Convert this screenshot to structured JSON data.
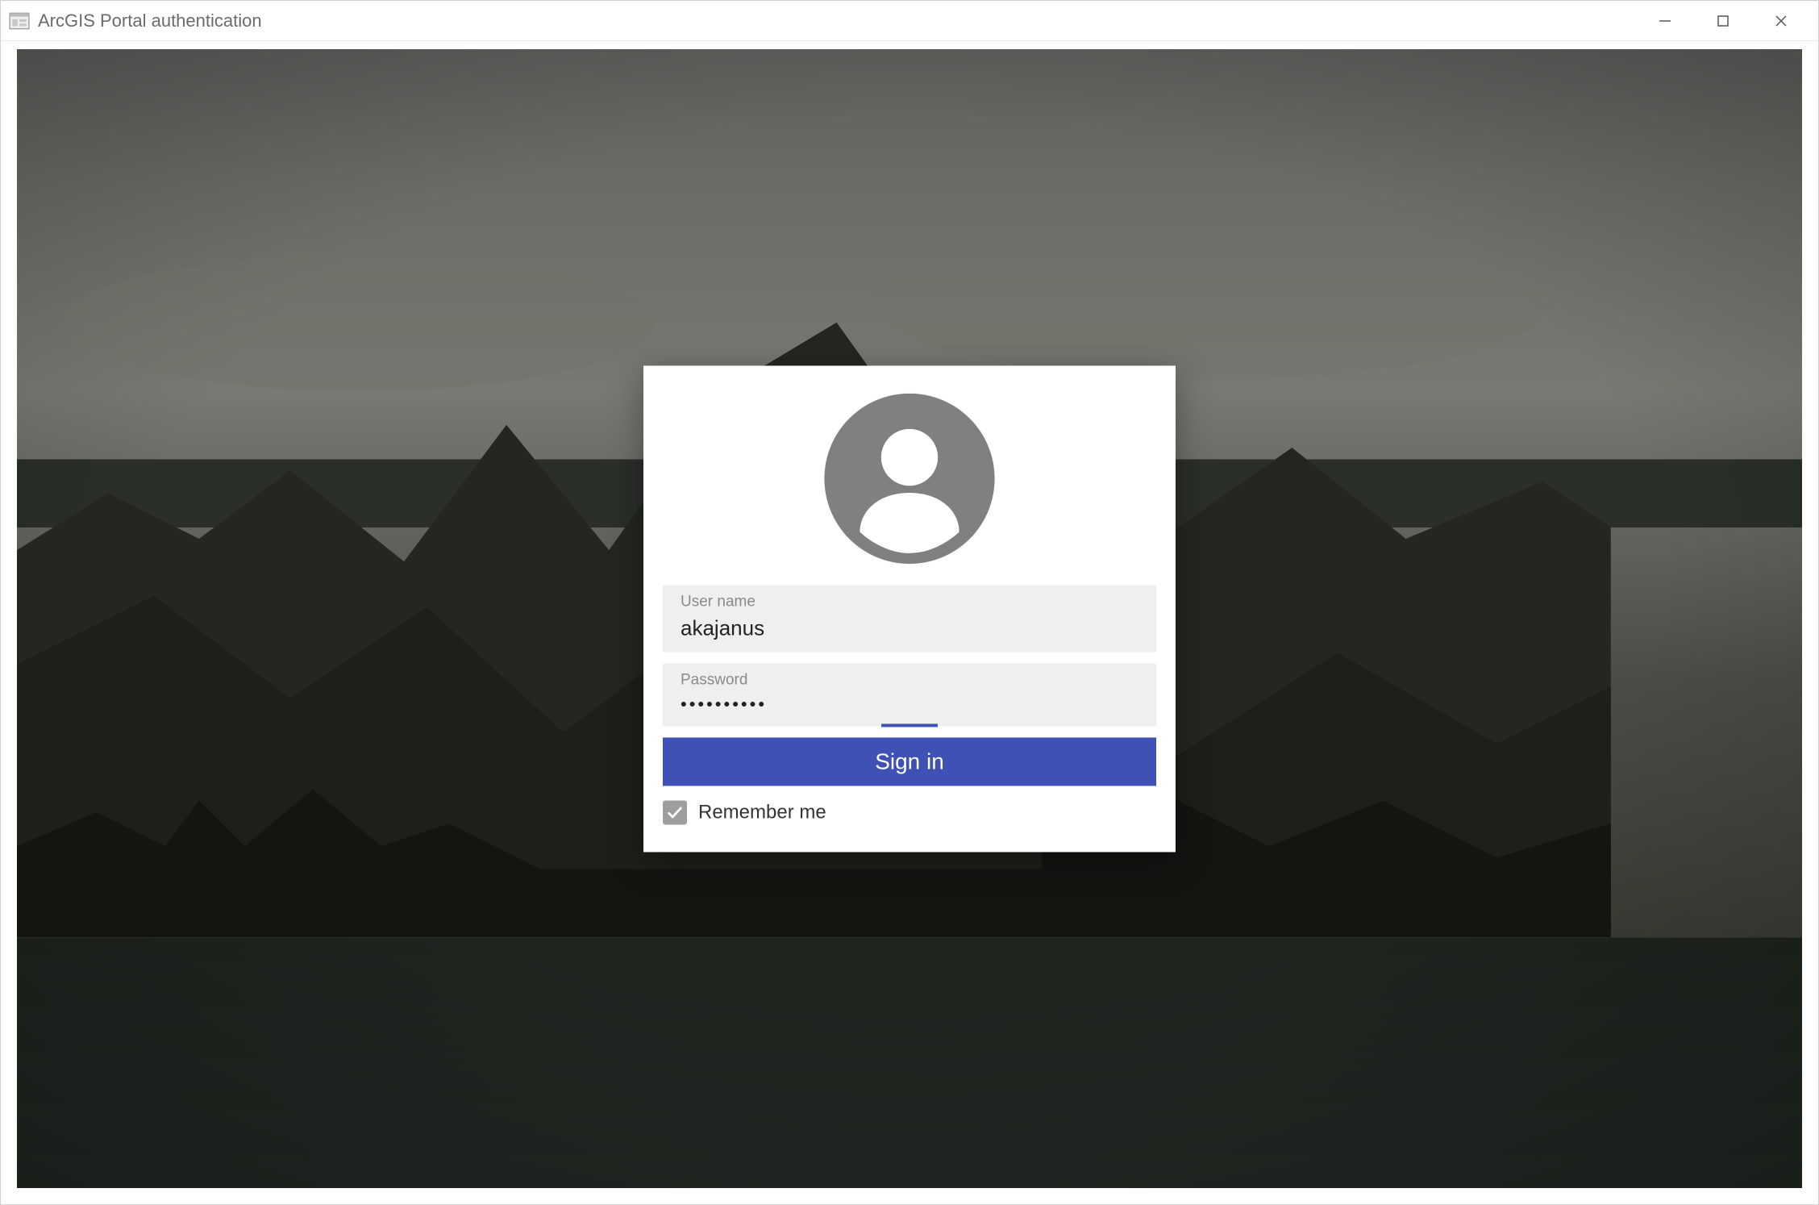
{
  "window": {
    "title": "ArcGIS Portal authentication"
  },
  "login": {
    "username_label": "User name",
    "username_value": "akajanus",
    "password_label": "Password",
    "password_value": "••••••••••",
    "signin_label": "Sign in",
    "remember_label": "Remember me",
    "remember_checked": true
  },
  "colors": {
    "primary": "#3f51b5",
    "field_bg": "#efefef",
    "checkbox_bg": "#9e9e9e"
  }
}
